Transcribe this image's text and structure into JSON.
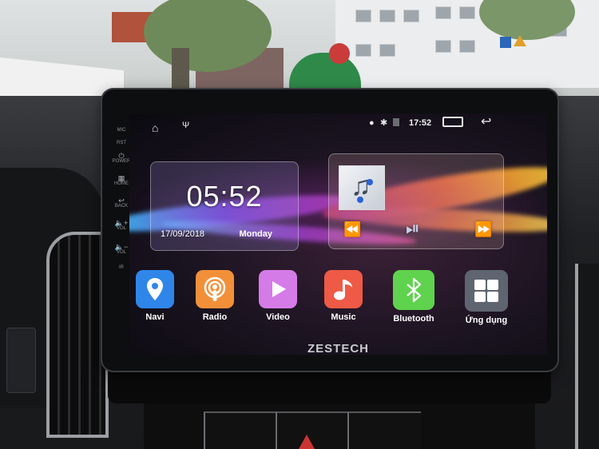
{
  "status_bar": {
    "left_icons": [
      "home-outline-icon",
      "usb-icon"
    ],
    "right_icons": [
      "location-icon",
      "bluetooth-icon",
      "no-sim-icon"
    ],
    "time": "17:52",
    "recent_apps_icon": "recent-apps-icon",
    "back_icon": "back-arrow-icon"
  },
  "clock_widget": {
    "time": "05:52",
    "date": "17/09/2018",
    "day": "Monday"
  },
  "music_widget": {
    "album_art": "music-note-album-art",
    "controls": {
      "previous": "⏪",
      "play_pause": "⏯",
      "next": "⏩"
    }
  },
  "apps": [
    {
      "label": "Navi",
      "icon": "map-pin-icon",
      "color": "#2f86e8"
    },
    {
      "label": "Radio",
      "icon": "podcast-icon",
      "color": "#f2903a"
    },
    {
      "label": "Video",
      "icon": "play-icon",
      "color": "#d57be8"
    },
    {
      "label": "Music",
      "icon": "music-note-icon",
      "color": "#ee5a45"
    },
    {
      "label": "Bluetooth",
      "icon": "bluetooth-icon",
      "color": "#5fd34e"
    },
    {
      "label": "Ứng dụng",
      "icon": "app-grid-icon",
      "color": "#5f6570"
    }
  ],
  "brand": "ZESTECH",
  "side_buttons": [
    {
      "label": "MIC"
    },
    {
      "label": "RST"
    },
    {
      "label": "POWER",
      "icon": "power-icon"
    },
    {
      "label": "HOME",
      "icon": "home-grid-icon"
    },
    {
      "label": "BACK",
      "icon": "back-icon"
    },
    {
      "label": "VOL",
      "icon": "volume-up-icon"
    },
    {
      "label": "VOL",
      "icon": "volume-down-icon"
    },
    {
      "label": "IR"
    }
  ]
}
